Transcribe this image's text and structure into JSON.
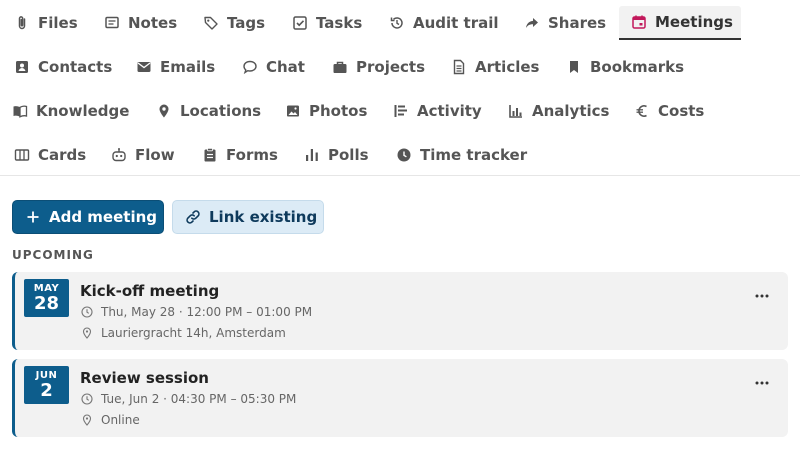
{
  "tabs": {
    "row1": [
      {
        "label": "Files",
        "icon": "paperclip-icon"
      },
      {
        "label": "Notes",
        "icon": "note-icon"
      },
      {
        "label": "Tags",
        "icon": "tag-icon"
      },
      {
        "label": "Tasks",
        "icon": "checkbox-icon"
      },
      {
        "label": "Audit trail",
        "icon": "history-icon"
      },
      {
        "label": "Shares",
        "icon": "share-icon"
      },
      {
        "label": "Meetings",
        "icon": "calendar-icon",
        "active": true
      }
    ],
    "row2": [
      {
        "label": "Contacts",
        "icon": "contact-icon"
      },
      {
        "label": "Emails",
        "icon": "envelope-icon"
      },
      {
        "label": "Chat",
        "icon": "chat-icon"
      },
      {
        "label": "Projects",
        "icon": "briefcase-icon"
      },
      {
        "label": "Articles",
        "icon": "document-icon"
      },
      {
        "label": "Bookmarks",
        "icon": "bookmark-icon"
      }
    ],
    "row3": [
      {
        "label": "Knowledge",
        "icon": "book-icon"
      },
      {
        "label": "Locations",
        "icon": "map-pin-icon"
      },
      {
        "label": "Photos",
        "icon": "image-icon"
      },
      {
        "label": "Activity",
        "icon": "activity-icon"
      },
      {
        "label": "Analytics",
        "icon": "bar-chart-icon"
      },
      {
        "label": "Costs",
        "icon": "euro-icon"
      }
    ],
    "row4": [
      {
        "label": "Cards",
        "icon": "columns-icon"
      },
      {
        "label": "Flow",
        "icon": "robot-icon"
      },
      {
        "label": "Forms",
        "icon": "clipboard-icon"
      },
      {
        "label": "Polls",
        "icon": "poll-icon"
      },
      {
        "label": "Time tracker",
        "icon": "clock-icon"
      }
    ]
  },
  "actions": {
    "add_label": "Add meeting",
    "link_label": "Link existing"
  },
  "section": {
    "upcoming_label": "UPCOMING"
  },
  "meetings": [
    {
      "month": "MAY",
      "day": "28",
      "title": "Kick-off meeting",
      "time": "Thu, May 28 · 12:00 PM – 01:00 PM",
      "location": "Lauriergracht 14h, Amsterdam"
    },
    {
      "month": "JUN",
      "day": "2",
      "title": "Review session",
      "time": "Tue, Jun 2 · 04:30 PM – 05:30 PM",
      "location": "Online"
    }
  ],
  "colors": {
    "primary": "#0d5d8c",
    "secondary_bg": "#dcebf6",
    "active_icon": "#c2185b",
    "card_bg": "#f2f2f2"
  }
}
